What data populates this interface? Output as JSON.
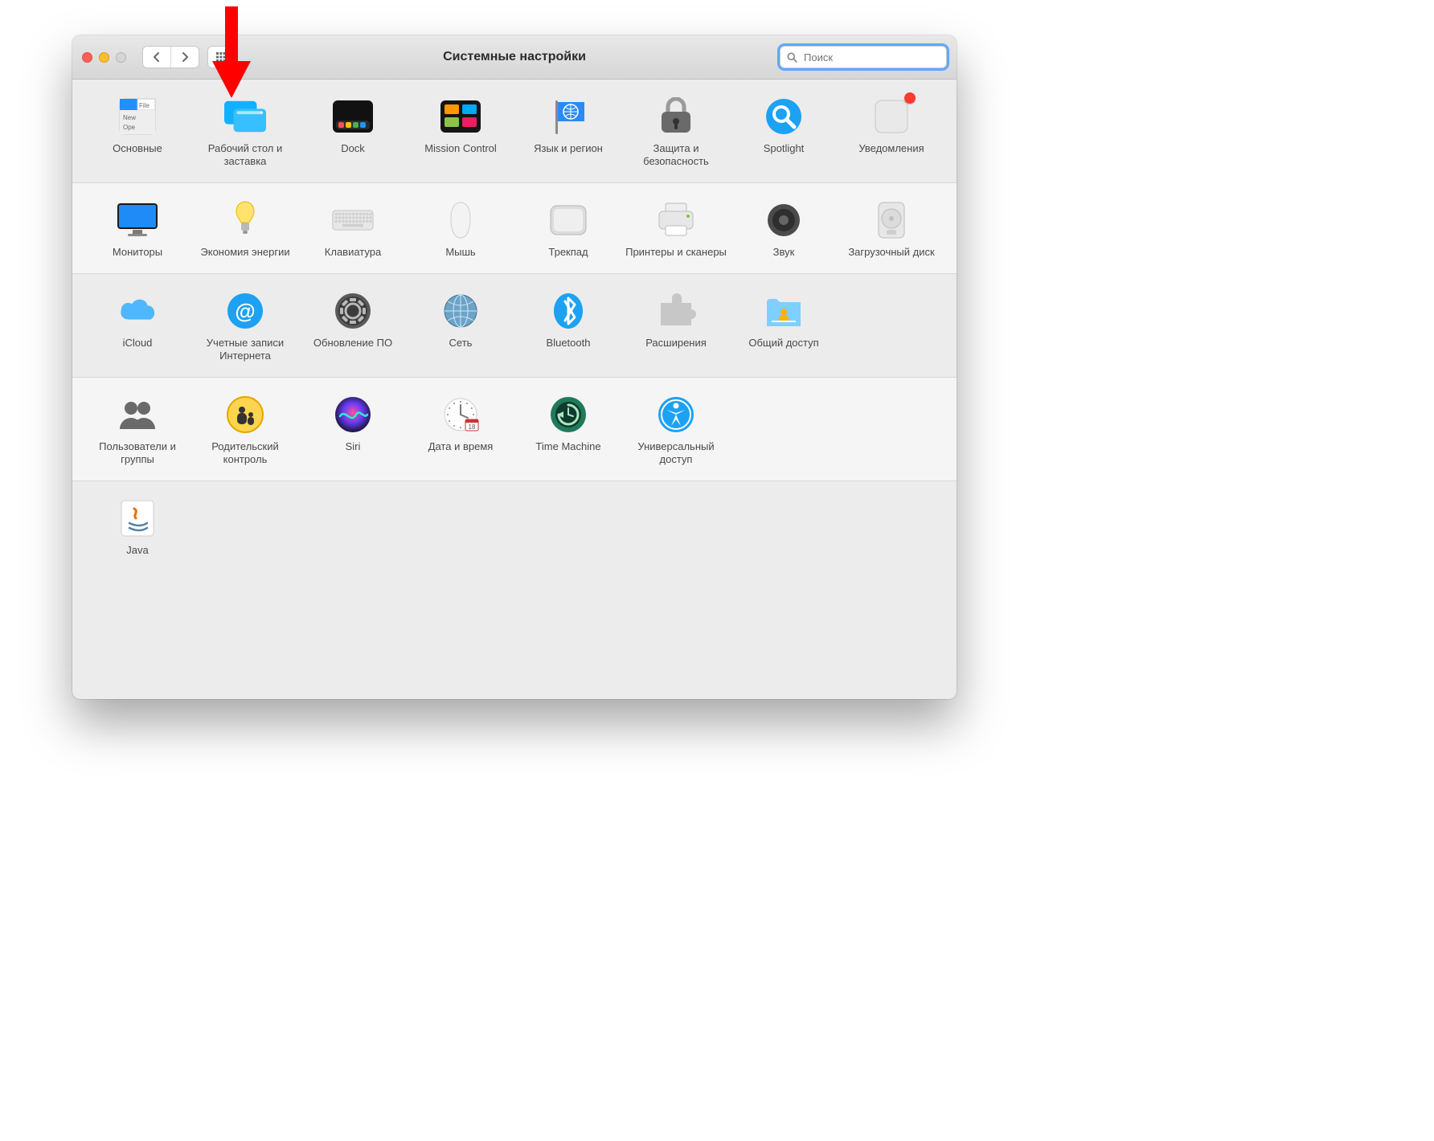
{
  "window": {
    "title": "Системные настройки"
  },
  "toolbar": {
    "search_placeholder": "Поиск"
  },
  "sections": [
    {
      "items": [
        {
          "id": "general",
          "label": "Основные"
        },
        {
          "id": "desktop-screensaver",
          "label": "Рабочий стол и заставка"
        },
        {
          "id": "dock",
          "label": "Dock"
        },
        {
          "id": "mission-control",
          "label": "Mission Control"
        },
        {
          "id": "language-region",
          "label": "Язык и регион"
        },
        {
          "id": "security-privacy",
          "label": "Защита и безопасность"
        },
        {
          "id": "spotlight",
          "label": "Spotlight"
        },
        {
          "id": "notifications",
          "label": "Уведомления",
          "badge": true
        }
      ]
    },
    {
      "items": [
        {
          "id": "displays",
          "label": "Мониторы"
        },
        {
          "id": "energy-saver",
          "label": "Экономия энергии"
        },
        {
          "id": "keyboard",
          "label": "Клавиатура"
        },
        {
          "id": "mouse",
          "label": "Мышь"
        },
        {
          "id": "trackpad",
          "label": "Трекпад"
        },
        {
          "id": "printers-scanners",
          "label": "Принтеры и сканеры"
        },
        {
          "id": "sound",
          "label": "Звук"
        },
        {
          "id": "startup-disk",
          "label": "Загрузочный диск"
        }
      ]
    },
    {
      "items": [
        {
          "id": "icloud",
          "label": "iCloud"
        },
        {
          "id": "internet-accounts",
          "label": "Учетные записи Интернета"
        },
        {
          "id": "software-update",
          "label": "Обновление ПО"
        },
        {
          "id": "network",
          "label": "Сеть"
        },
        {
          "id": "bluetooth",
          "label": "Bluetooth"
        },
        {
          "id": "extensions",
          "label": "Расширения"
        },
        {
          "id": "sharing",
          "label": "Общий доступ"
        }
      ]
    },
    {
      "items": [
        {
          "id": "users-groups",
          "label": "Пользователи и группы"
        },
        {
          "id": "parental-controls",
          "label": "Родительский контроль"
        },
        {
          "id": "siri",
          "label": "Siri"
        },
        {
          "id": "date-time",
          "label": "Дата и время"
        },
        {
          "id": "time-machine",
          "label": "Time Machine"
        },
        {
          "id": "accessibility",
          "label": "Универсальный доступ"
        }
      ]
    },
    {
      "items": [
        {
          "id": "java",
          "label": "Java"
        }
      ]
    }
  ],
  "annotation": {
    "arrow_target": "desktop-screensaver"
  }
}
